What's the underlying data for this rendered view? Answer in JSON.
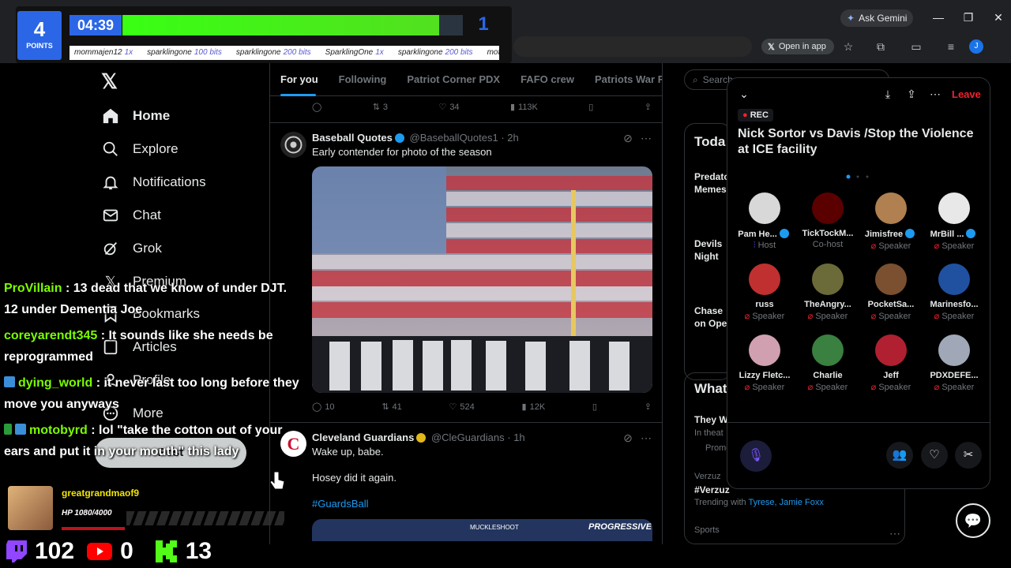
{
  "browser": {
    "gemini_label": "Ask Gemini",
    "open_in_app_label": "Open in app",
    "profile_initial": "J"
  },
  "nav": {
    "items": [
      {
        "label": "Home",
        "icon": "home-icon"
      },
      {
        "label": "Explore",
        "icon": "search-icon"
      },
      {
        "label": "Notifications",
        "icon": "bell-icon"
      },
      {
        "label": "Chat",
        "icon": "mail-icon"
      },
      {
        "label": "Grok",
        "icon": "grok-icon"
      },
      {
        "label": "Premium",
        "icon": "premium-icon"
      },
      {
        "label": "Bookmarks",
        "icon": "bookmark-icon"
      },
      {
        "label": "Articles",
        "icon": "article-icon"
      },
      {
        "label": "Profile",
        "icon": "person-icon"
      },
      {
        "label": "More",
        "icon": "more-icon"
      }
    ],
    "post_label": "Post"
  },
  "feed": {
    "tabs": [
      "For you",
      "Following",
      "Patriot Corner PDX",
      "FAFO crew",
      "Patriots War Room"
    ],
    "top_actions": {
      "retweets": "3",
      "likes": "34",
      "views": "113K"
    },
    "post1": {
      "name": "Baseball Quotes",
      "handle": "@BaseballQuotes1",
      "time": "· 2h",
      "text": "Early contender for photo of the season",
      "replies": "10",
      "retweets": "41",
      "likes": "524",
      "views": "12K"
    },
    "post2": {
      "name": "Cleveland Guardians",
      "handle": "@CleGuardians",
      "time": "· 1h",
      "line1": "Wake up, babe.",
      "line2": "Hosey did it again.",
      "hashtag": "#GuardsBall",
      "banner_left": "MUCKLESHOOT",
      "banner_right": "PROGRESSIVE"
    }
  },
  "right": {
    "search_placeholder": "Search",
    "today_title": "Toda",
    "today_items": [
      "Predato Memes",
      "Devils Night",
      "Chase on Ope"
    ],
    "whats_title": "What",
    "whats_items": [
      {
        "title": "They W",
        "sub": "In theat",
        "promo": "Promo"
      },
      {
        "context": "Verzuz",
        "title": "#Verzuz",
        "sub": "Trending with",
        "links": "Tyrese, Jamie Foxx"
      },
      {
        "context": "Sports"
      }
    ]
  },
  "space": {
    "rec_label": "REC",
    "leave_label": "Leave",
    "title": "Nick Sortor vs Davis /Stop the Violence at ICE facility",
    "participants": [
      {
        "name": "Pam He...",
        "role": "Host",
        "verified": true,
        "color": "#d8d8d8"
      },
      {
        "name": "TickTockM...",
        "role": "Co-host",
        "verified": false,
        "color": "#5a0000"
      },
      {
        "name": "Jimisfree",
        "role": "Speaker",
        "verified": true,
        "color": "#b08050"
      },
      {
        "name": "MrBill ...",
        "role": "Speaker",
        "verified": true,
        "color": "#e8e8e8"
      },
      {
        "name": "russ",
        "role": "Speaker",
        "verified": false,
        "color": "#c03030"
      },
      {
        "name": "TheAngry...",
        "role": "Speaker",
        "verified": false,
        "color": "#6b6b3a"
      },
      {
        "name": "PocketSa...",
        "role": "Speaker",
        "verified": false,
        "color": "#7a5030"
      },
      {
        "name": "Marinesfo...",
        "role": "Speaker",
        "verified": false,
        "color": "#2050a0"
      },
      {
        "name": "Lizzy Fletc...",
        "role": "Speaker",
        "verified": false,
        "color": "#d0a0b0"
      },
      {
        "name": "Charlie",
        "role": "Speaker",
        "verified": false,
        "color": "#3a8040"
      },
      {
        "name": "Jeff",
        "role": "Speaker",
        "verified": false,
        "color": "#b02030"
      },
      {
        "name": "PDXDEFE...",
        "role": "Speaker",
        "verified": false,
        "color": "#a0a8b8"
      }
    ]
  },
  "overlay": {
    "points_value": "4",
    "points_label": "POINTS",
    "timer": "04:39",
    "progress": 0.93,
    "round": "1",
    "ticker": [
      {
        "user": "mommajen12",
        "amt": "1x"
      },
      {
        "user": "sparklingone",
        "amt": "100 bits"
      },
      {
        "user": "sparklingone",
        "amt": "200 bits"
      },
      {
        "user": "SparklingOne",
        "amt": "1x"
      },
      {
        "user": "sparklingone",
        "amt": "200 bits"
      },
      {
        "user": "mofolyo",
        "amt": ""
      }
    ],
    "chat": [
      {
        "user": "ProVillain",
        "msg": ": 13 dead that we know of under DJT. 12 under Dementia Joe"
      },
      {
        "user": "coreyarendt345",
        "msg": ": It sounds like she needs be reprogrammed"
      },
      {
        "user": "dying_world",
        "msg": ": it never last too long before they move you anyways"
      },
      {
        "user": "motobyrd",
        "msg": ": lol \"take the cotton out of your ears and put it in your mouth\" this lady"
      }
    ],
    "follower_name": "greatgrandmaof9",
    "follower_hp": "HP 1080/4000",
    "twitch_count": "102",
    "youtube_count": "0",
    "kick_count": "13"
  }
}
